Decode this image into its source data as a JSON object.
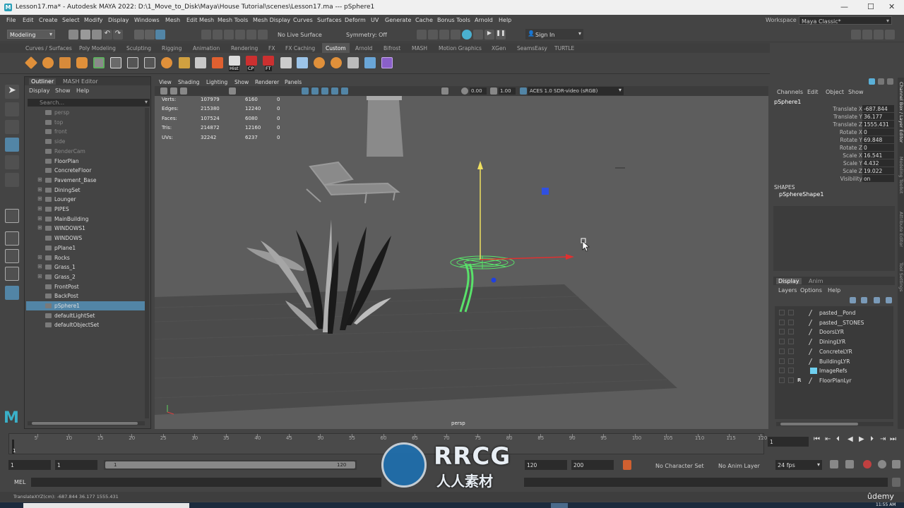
{
  "titlebar": {
    "title": "Lesson17.ma* - Autodesk MAYA 2022: D:\\1_Move_to_Disk\\Maya\\House Tutorial\\scenes\\Lesson17.ma   ---   pSphere1",
    "minimize": "—",
    "maximize": "☐",
    "close": "✕"
  },
  "menubar": {
    "items": [
      "File",
      "Edit",
      "Create",
      "Select",
      "Modify",
      "Display",
      "Windows",
      "Mesh",
      "Edit Mesh",
      "Mesh Tools",
      "Mesh Display",
      "Curves",
      "Surfaces",
      "Deform",
      "UV",
      "Generate",
      "Cache",
      "Bonus Tools",
      "Arnold",
      "Help"
    ],
    "workspace_label": "Workspace :",
    "workspace_value": "Maya Classic*"
  },
  "statusline": {
    "mode": "Modeling",
    "live_surface": "No Live Surface",
    "symmetry": "Symmetry: Off",
    "sign_in": "Sign In"
  },
  "shelf": {
    "tabs": [
      "Curves / Surfaces",
      "Poly Modeling",
      "Sculpting",
      "Rigging",
      "Animation",
      "Rendering",
      "FX",
      "FX Caching",
      "Custom",
      "Arnold",
      "Bifrost",
      "MASH",
      "Motion Graphics",
      "XGen",
      "SeamsEasy",
      "TURTLE"
    ],
    "active_tab": "Custom",
    "labels": [
      "Hist",
      "CP",
      "FT"
    ]
  },
  "outliner": {
    "tabs": [
      "Outliner",
      "MASH Editor"
    ],
    "menu": [
      "Display",
      "Show",
      "Help"
    ],
    "search_placeholder": "Search...",
    "items": [
      {
        "label": "persp",
        "expand": "",
        "dim": true
      },
      {
        "label": "top",
        "expand": "",
        "dim": true
      },
      {
        "label": "front",
        "expand": "",
        "dim": true
      },
      {
        "label": "side",
        "expand": "",
        "dim": true
      },
      {
        "label": "RenderCam",
        "expand": "",
        "dim": true
      },
      {
        "label": "FloorPlan",
        "expand": "",
        "dim": false
      },
      {
        "label": "ConcreteFloor",
        "expand": "",
        "dim": false
      },
      {
        "label": "Pavement_Base",
        "expand": "⊞",
        "dim": false
      },
      {
        "label": "DiningSet",
        "expand": "⊞",
        "dim": false
      },
      {
        "label": "Lounger",
        "expand": "⊞",
        "dim": false
      },
      {
        "label": "PIPES",
        "expand": "⊞",
        "dim": false
      },
      {
        "label": "MainBuilding",
        "expand": "⊞",
        "dim": false
      },
      {
        "label": "WINDOWS1",
        "expand": "⊞",
        "dim": false
      },
      {
        "label": "WINDOWS",
        "expand": "",
        "dim": false
      },
      {
        "label": "pPlane1",
        "expand": "",
        "dim": false
      },
      {
        "label": "Rocks",
        "expand": "⊞",
        "dim": false
      },
      {
        "label": "Grass_1",
        "expand": "⊞",
        "dim": false
      },
      {
        "label": "Grass_2",
        "expand": "⊞",
        "dim": false
      },
      {
        "label": "FrontPost",
        "expand": "",
        "dim": false
      },
      {
        "label": "BackPost",
        "expand": "",
        "dim": false
      },
      {
        "label": "pSphere1",
        "expand": "",
        "dim": false,
        "selected": true
      },
      {
        "label": "defaultLightSet",
        "expand": "",
        "dim": false
      },
      {
        "label": "defaultObjectSet",
        "expand": "",
        "dim": false
      }
    ]
  },
  "viewport": {
    "menu": [
      "View",
      "Shading",
      "Lighting",
      "Show",
      "Renderer",
      "Panels"
    ],
    "exposure": "0.00",
    "gamma": "1.00",
    "color_space": "ACES 1.0 SDR-video (sRGB)",
    "camera_label": "persp",
    "hud": [
      {
        "label": "Verts:",
        "a": "107979",
        "b": "6160",
        "c": "0"
      },
      {
        "label": "Edges:",
        "a": "215380",
        "b": "12240",
        "c": "0"
      },
      {
        "label": "Faces:",
        "a": "107524",
        "b": "6080",
        "c": "0"
      },
      {
        "label": "Tris:",
        "a": "214872",
        "b": "12160",
        "c": "0"
      },
      {
        "label": "UVs:",
        "a": "32242",
        "b": "6237",
        "c": "0"
      }
    ]
  },
  "channelbox": {
    "menu": [
      "Channels",
      "Edit",
      "Object",
      "Show"
    ],
    "object_name": "pSphere1",
    "attrs": [
      {
        "k": "Translate X",
        "v": "-687.844"
      },
      {
        "k": "Translate Y",
        "v": "36.177"
      },
      {
        "k": "Translate Z",
        "v": "1555.431"
      },
      {
        "k": "Rotate X",
        "v": "0"
      },
      {
        "k": "Rotate Y",
        "v": "69.848"
      },
      {
        "k": "Rotate Z",
        "v": "0"
      },
      {
        "k": "Scale X",
        "v": "16.541"
      },
      {
        "k": "Scale Y",
        "v": "4.432"
      },
      {
        "k": "Scale Z",
        "v": "19.022"
      },
      {
        "k": "Visibility",
        "v": "on"
      }
    ],
    "shapes_label": "SHAPES",
    "shape_name": "pSphereShape1",
    "layer_tabs": [
      "Display",
      "Anim"
    ],
    "layer_menu": [
      "Layers",
      "Options",
      "Help"
    ],
    "layers": [
      {
        "name": "pasted__Pond",
        "flag": ""
      },
      {
        "name": "pasted__STONES",
        "flag": ""
      },
      {
        "name": "DoorsLYR",
        "flag": ""
      },
      {
        "name": "DiningLYR",
        "flag": ""
      },
      {
        "name": "ConcreteLYR",
        "flag": ""
      },
      {
        "name": "BuildingLYR",
        "flag": ""
      },
      {
        "name": "ImageRefs",
        "flag": "",
        "swatch": "#6fd0f0"
      },
      {
        "name": "FloorPlanLyr",
        "flag": "R"
      }
    ],
    "side_tabs": [
      "Channel Box / Layer Editor",
      "Modeling Toolkit",
      "Attribute Editor",
      "Tool Settings"
    ]
  },
  "timeline": {
    "ticks": [
      "5",
      "10",
      "15",
      "20",
      "25",
      "30",
      "35",
      "40",
      "45",
      "50",
      "55",
      "60",
      "65",
      "70",
      "75",
      "80",
      "85",
      "90",
      "95",
      "100",
      "105",
      "110",
      "115",
      "120"
    ],
    "start_marker": "1",
    "current_frame": "1"
  },
  "range": {
    "start": "1",
    "inner_start": "1",
    "slider_start": "1",
    "slider_end": "120",
    "end": "120",
    "anim_end": "200",
    "character_set": "No Character Set",
    "anim_layer": "No Anim Layer",
    "fps": "24 fps"
  },
  "mel": {
    "label": "MEL"
  },
  "helpline": {
    "text": "TranslateXYZ(cm):     -687.844       36.177       1555.431"
  },
  "watermark": {
    "big": "RRCG",
    "small": "人人素材"
  },
  "brand": {
    "udemy": "ûdemy",
    "clock": "11:55 AM"
  },
  "colors": {
    "selected_row": "#5285a6",
    "wire_green": "#59e26a",
    "axis_red": "#e03030",
    "axis_yellow": "#f0e060",
    "axis_blue": "#2040e0",
    "maya_logo": "#3ab0c8"
  }
}
